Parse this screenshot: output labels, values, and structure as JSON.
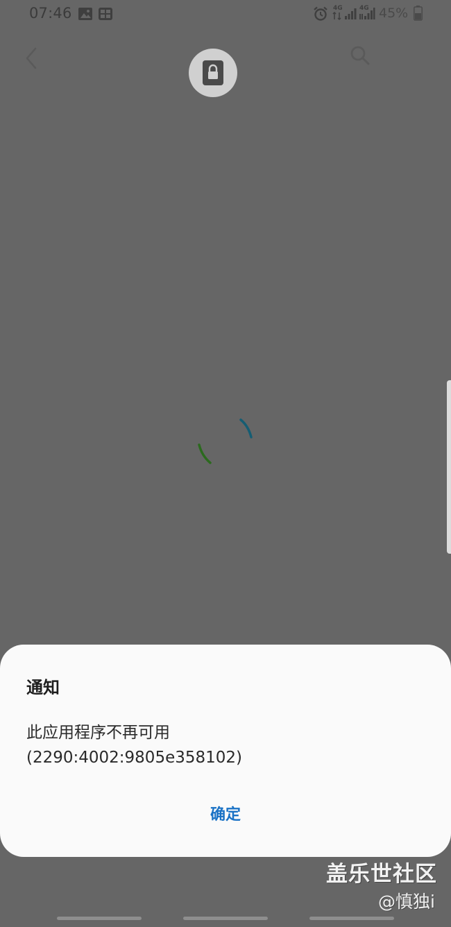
{
  "status_bar": {
    "time": "07:46",
    "network_label_1": "4G",
    "network_label_2": "4G",
    "battery": "45%"
  },
  "icons": {
    "back": "chevron-left-icon",
    "lock": "lock-icon",
    "search": "search-icon",
    "spinner": "loading-spinner-icon"
  },
  "dialog": {
    "title": "通知",
    "message": "此应用程序不再可用\n(2290:4002:9805e358102)",
    "confirm_label": "确定"
  },
  "watermark": {
    "site": "盖乐世社区",
    "user": "@慎独i"
  },
  "colors": {
    "overlay": "#666666",
    "dialog_bg": "#fafafa",
    "accent": "#1a72c5",
    "spinner_green": "#2b6a1e",
    "spinner_teal": "#155d73"
  }
}
